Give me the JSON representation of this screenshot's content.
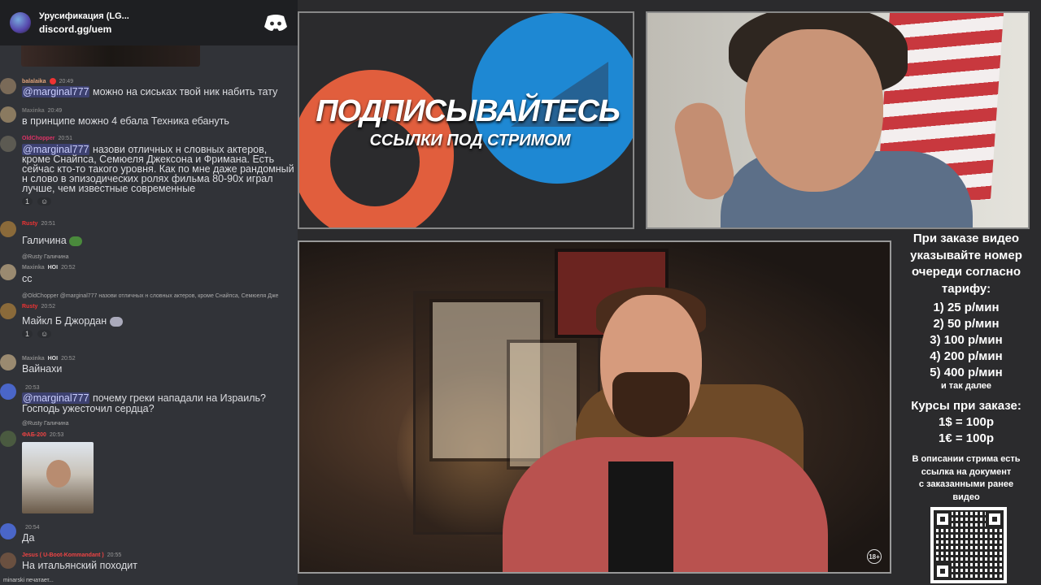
{
  "discord": {
    "server_name": "Урусификация (LG...",
    "invite": "discord.gg/uem",
    "typing": "minarski печатает..."
  },
  "messages": [
    {
      "user": "balalaika",
      "time": "20:49",
      "mention": "@marginal777",
      "text": "можно на сиськах твой ник набить тату"
    },
    {
      "user": "Maxinka",
      "time": "20:49",
      "text": "в принципе можно 4 ебала Техника ебануть"
    },
    {
      "user": "OldChopper",
      "time": "20:51",
      "mention": "@marginal777",
      "text": "назови отличных н словных актеров, кроме Снайпса, Семюеля Джексона и Фримана. Есть сейчас кто-то такого уровня. Как по мне даже рандомный н слово в эпизодических ролях фильма 80-90х играл лучше, чем известные современные",
      "reactions": [
        "1"
      ]
    },
    {
      "user": "Rusty",
      "time": "20:51",
      "text": "Галичина"
    },
    {
      "reply": "@Rusty Галичина",
      "user": "Maxinka",
      "tag": "HOI",
      "time": "20:52",
      "text": "сс"
    },
    {
      "reply": "@OldChopper @marginal777 назови отличных н словных актеров, кроме Снайпса, Семюеля Дже",
      "user": "Rusty",
      "time": "20:52",
      "text": "Майкл Б Джордан",
      "reactions": [
        "1"
      ]
    },
    {
      "user": "Maxinka",
      "tag": "HOI",
      "time": "20:52",
      "text": "Вайнахи"
    },
    {
      "user": "",
      "time": "20:53",
      "mention": "@marginal777",
      "text": "почему греки нападали на Израиль? Господь ужесточил сердца?"
    },
    {
      "reply": "@Rusty Галичина",
      "user": "ФАБ-200",
      "time": "20:53",
      "text": ""
    },
    {
      "user": "",
      "time": "20:54",
      "text": "Да"
    },
    {
      "user": "Jesus ( U-Boot-Kommandant )",
      "time": "20:55",
      "text": "На итальянский походит"
    }
  ],
  "promo": {
    "title": "ПОДПИСЫВАЙТЕСЬ",
    "subtitle": "ССЫЛКИ ПОД СТРИМОМ"
  },
  "info": {
    "header": [
      "При заказе видео",
      "указывайте номер",
      "очереди согласно",
      "тарифу:"
    ],
    "tariffs": [
      "1) 25 р/мин",
      "2) 50 р/мин",
      "3) 100 р/мин",
      "4) 200 р/мин",
      "5) 400 р/мин"
    ],
    "and_more": "и так далее",
    "rates_title": "Курсы при заказе:",
    "rates": [
      "1$ = 100р",
      "1€ = 100р"
    ],
    "note": [
      "В описании стрима есть",
      "ссылка на документ",
      "с заказанными ранее",
      "видео"
    ]
  },
  "rating_badge": "18+"
}
